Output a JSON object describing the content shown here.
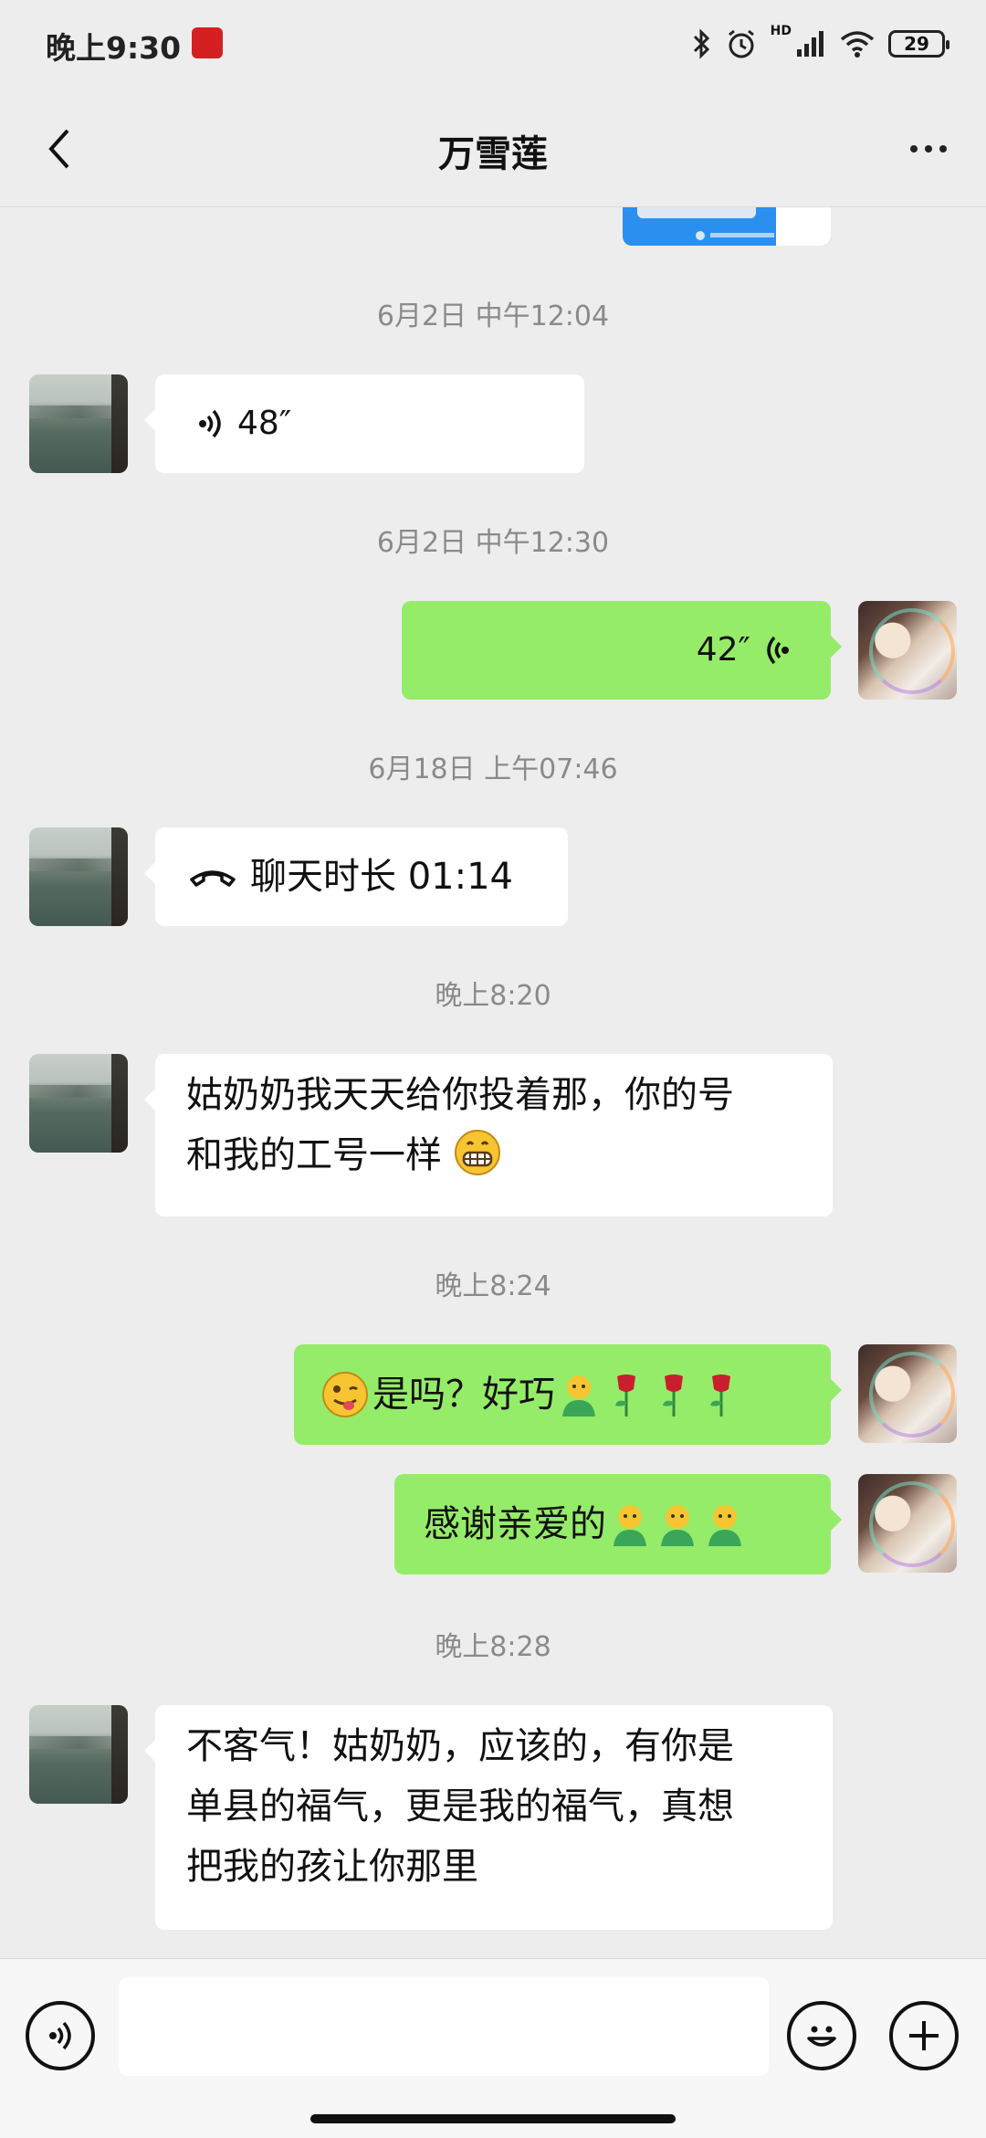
{
  "status_bar": {
    "time": "晚上9:30",
    "app_badge_icon": "red-app-badge-icon",
    "hd_label": "HD",
    "battery_level": "29",
    "icons": [
      "bluetooth-icon",
      "alarm-icon",
      "signal-icon",
      "wifi-icon",
      "battery-icon"
    ]
  },
  "header": {
    "title": "万雪莲",
    "back_icon": "chevron-left-icon",
    "more_icon": "more-dots-icon"
  },
  "messages": [
    {
      "type": "timestamp",
      "text": "6月2日 中午12:04"
    },
    {
      "type": "voice",
      "side": "in",
      "duration": "48″"
    },
    {
      "type": "timestamp",
      "text": "6月2日 中午12:30"
    },
    {
      "type": "voice",
      "side": "out",
      "duration": "42″"
    },
    {
      "type": "timestamp",
      "text": "6月18日 上午07:46"
    },
    {
      "type": "call",
      "side": "in",
      "text": "聊天时长 01:14"
    },
    {
      "type": "timestamp",
      "text": "晚上8:20"
    },
    {
      "type": "text",
      "side": "in",
      "line1": "姑奶奶我天天给你投着那，你的号",
      "line2": "和我的工号一样"
    },
    {
      "type": "timestamp",
      "text": "晚上8:24"
    },
    {
      "type": "text",
      "side": "out",
      "text": "是吗？好巧"
    },
    {
      "type": "text",
      "side": "out",
      "text": "感谢亲爱的"
    },
    {
      "type": "timestamp",
      "text": "晚上8:28"
    },
    {
      "type": "text",
      "side": "in",
      "line1": "不客气！姑奶奶，应该的，有你是",
      "line2": "单县的福气，更是我的福气，真想",
      "line3": "把我的孩让你那里"
    }
  ],
  "composer": {
    "voice_toggle_icon": "voice-icon",
    "input_value": "",
    "emoji_icon": "emoji-icon",
    "plus_icon": "plus-icon"
  },
  "colors": {
    "background": "#ededed",
    "outgoing_bubble": "#95ec69",
    "incoming_bubble": "#ffffff",
    "timestamp": "#8a8a8a"
  }
}
